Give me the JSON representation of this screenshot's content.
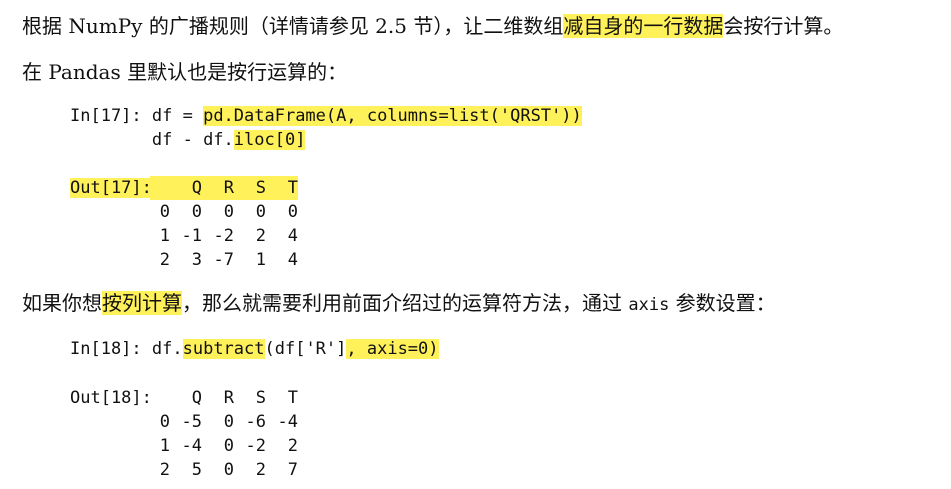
{
  "para1": {
    "before": "根据 NumPy 的广播规则（详情请参见 2.5 节），让二维数组",
    "highlight": "减自身的一行数据",
    "after": "会按行计算。"
  },
  "para2": {
    "text": "在 Pandas 里默认也是按行运算的："
  },
  "cell17": {
    "in_prompt": "In[17]: ",
    "line1_before": "df = ",
    "line1_highlight": "pd.DataFrame(A, columns=list('QRST'))",
    "line2_indent": "        ",
    "line2_before": "df - df.",
    "line2_highlight": "iloc[0]",
    "out_prompt": "Out[17]:",
    "table": {
      "columns": [
        "Q",
        "R",
        "S",
        "T"
      ],
      "index": [
        "0",
        "1",
        "2"
      ],
      "rows": [
        [
          "0",
          "0",
          "0",
          "0"
        ],
        [
          "-1",
          "-2",
          "2",
          "4"
        ],
        [
          "3",
          "-7",
          "1",
          "4"
        ]
      ]
    }
  },
  "para3": {
    "before": "如果你想",
    "highlight": "按列计算",
    "middle": "，那么就需要利用前面介绍过的运算符方法，通过 ",
    "code": "axis",
    "after": " 参数设置："
  },
  "cell18": {
    "in_prompt": "In[18]: ",
    "line1_before": "df.",
    "line1_highlight": "subtract",
    "line1_middle": "(df['R']",
    "line1_highlight2": ", axis=0)",
    "out_prompt": "Out[18]:",
    "table": {
      "columns": [
        "Q",
        "R",
        "S",
        "T"
      ],
      "index": [
        "0",
        "1",
        "2"
      ],
      "rows": [
        [
          "-5",
          "0",
          "-6",
          "-4"
        ],
        [
          "-4",
          "0",
          "-2",
          "2"
        ],
        [
          "5",
          "0",
          "2",
          "7"
        ]
      ]
    }
  },
  "colors": {
    "highlight": "#fff15a",
    "text": "#111111"
  }
}
